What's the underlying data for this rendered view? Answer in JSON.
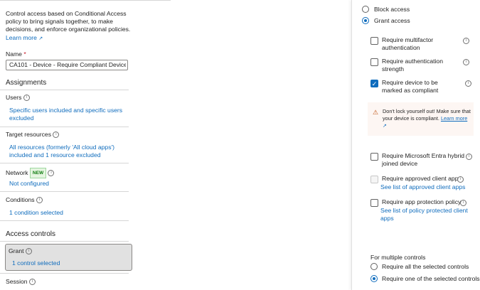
{
  "left": {
    "description": "Control access based on Conditional Access policy to bring signals together, to make decisions, and enforce organizational policies.",
    "learn_more": "Learn more",
    "name_label": "Name",
    "name_required": "*",
    "name_value": "CA101 - Device - Require Compliant Device ...",
    "assignments_heading": "Assignments",
    "users_label": "Users",
    "users_value": "Specific users included and specific users excluded",
    "target_label": "Target resources",
    "target_value": "All resources (formerly 'All cloud apps') included and 1 resource excluded",
    "network_label": "Network",
    "network_badge": "NEW",
    "network_value": "Not configured",
    "conditions_label": "Conditions",
    "conditions_value": "1 condition selected",
    "access_heading": "Access controls",
    "grant_label": "Grant",
    "grant_value": "1 control selected",
    "session_label": "Session"
  },
  "panel": {
    "block_access": "Block access",
    "grant_access": "Grant access",
    "mfa": "Require multifactor authentication",
    "auth_strength": "Require authentication strength",
    "compliant": "Require device to be marked as compliant",
    "warning_text": "Don't lock yourself out! Make sure that your device is compliant.",
    "warning_link": "Learn more",
    "hybrid": "Require Microsoft Entra hybrid joined device",
    "approved_app": "Require approved client app",
    "approved_app_link": "See list of approved client apps",
    "app_protection": "Require app protection policy",
    "app_protection_link": "See list of policy protected client apps",
    "multiple_label": "For multiple controls",
    "require_all": "Require all the selected controls",
    "require_one": "Require one of the selected controls"
  },
  "colors": {
    "accent": "#0f6cbd",
    "warning_bg": "#fdf6f3",
    "grant_bg": "#e1e1e1",
    "badge_green": "#107c10"
  }
}
